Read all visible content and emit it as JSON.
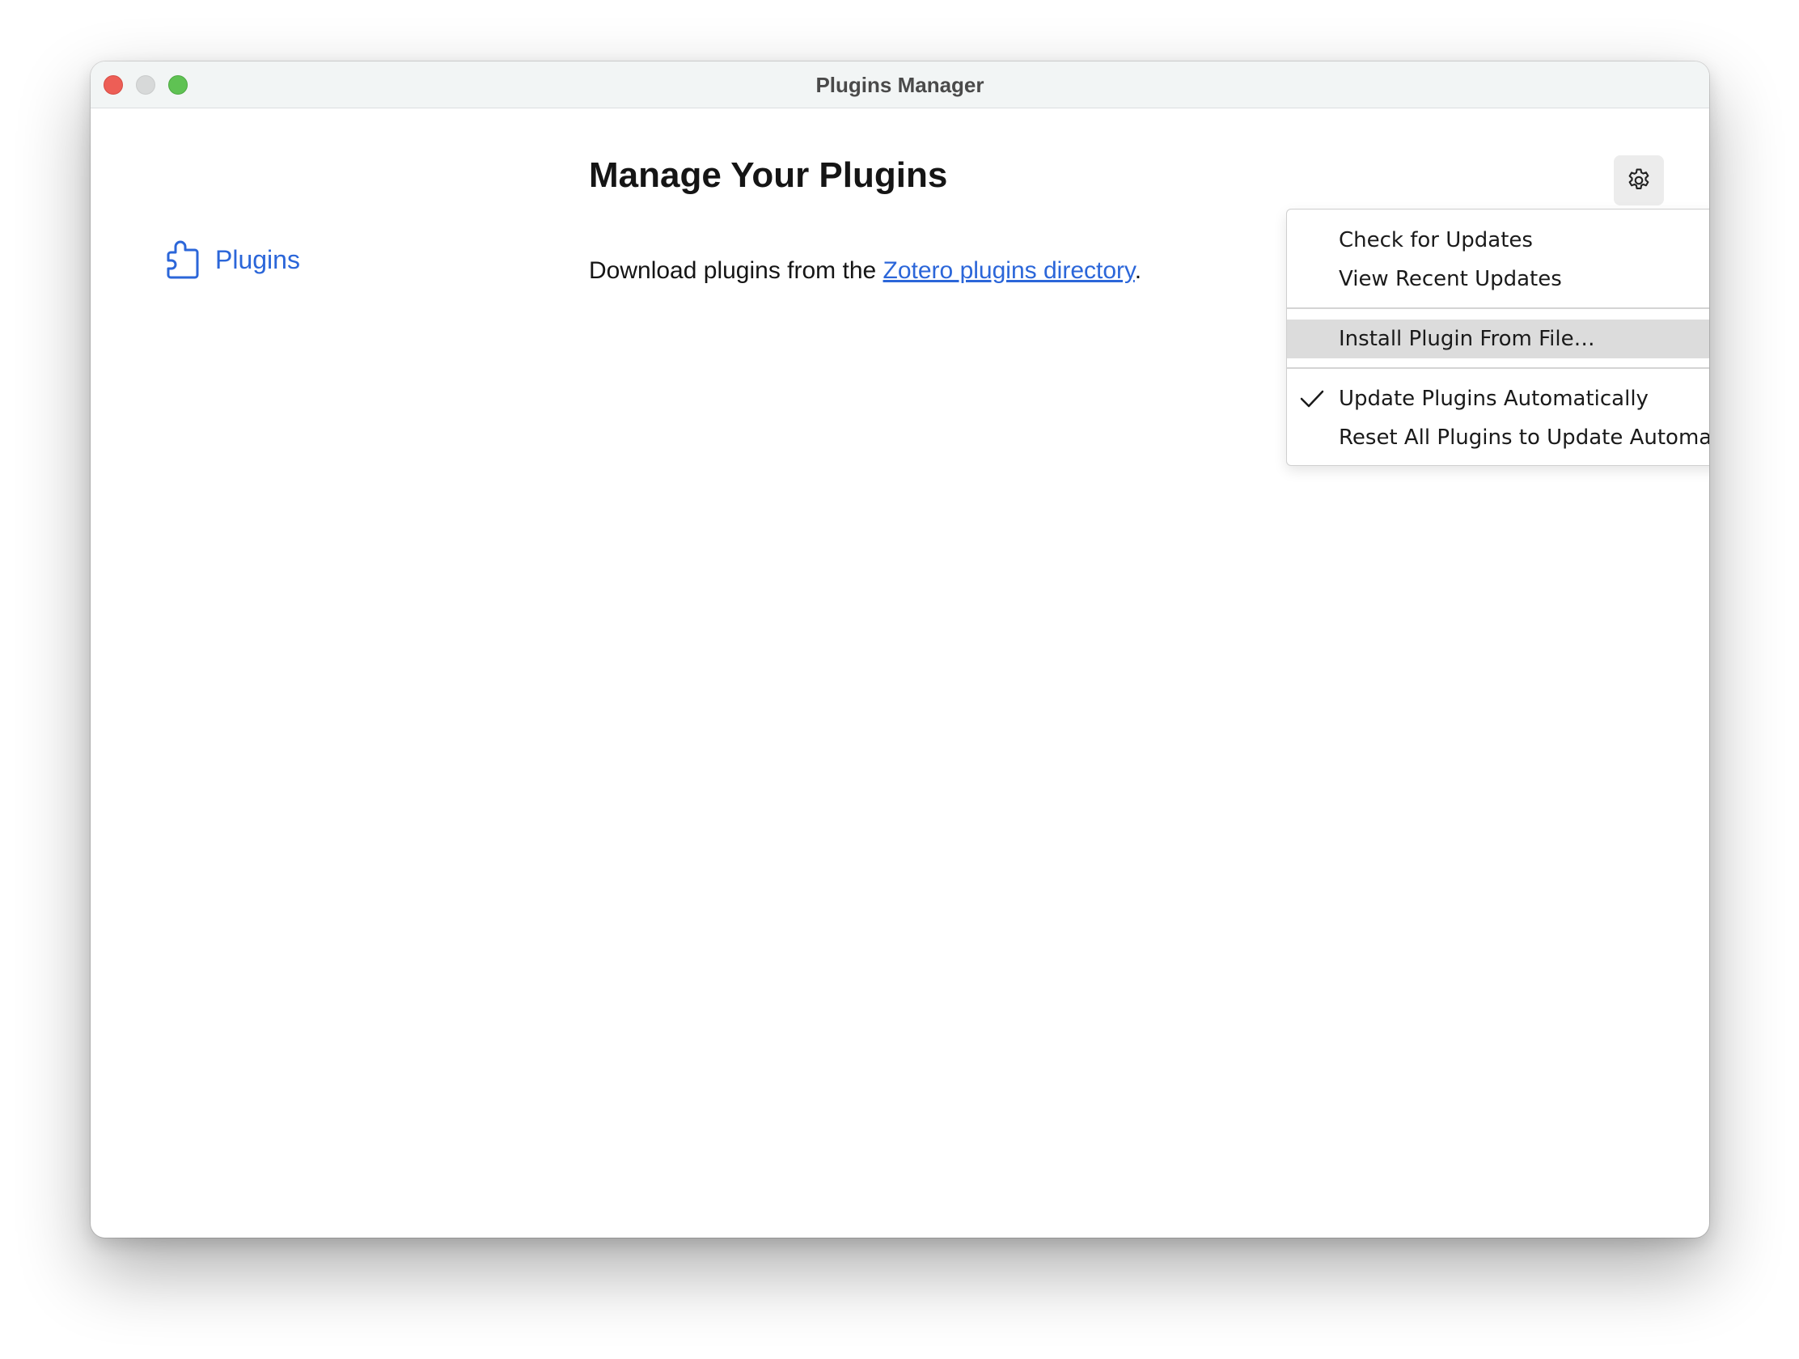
{
  "window": {
    "title": "Plugins Manager"
  },
  "sidebar": {
    "items": [
      {
        "label": "Plugins",
        "icon": "puzzle-piece-icon",
        "selected": true
      }
    ]
  },
  "main": {
    "title": "Manage Your Plugins",
    "intro_prefix": "Download plugins from the ",
    "intro_link": "Zotero plugins directory",
    "intro_suffix": "."
  },
  "toolbar": {
    "settings_icon": "gear-icon"
  },
  "menu": {
    "items": [
      {
        "label": "Check for Updates",
        "checked": false
      },
      {
        "label": "View Recent Updates",
        "checked": false
      },
      {
        "label": "Install Plugin From File…",
        "checked": false,
        "highlighted": true
      },
      {
        "label": "Update Plugins Automatically",
        "checked": true
      },
      {
        "label": "Reset All Plugins to Update Automatically",
        "checked": false
      }
    ]
  },
  "colors": {
    "accent": "#2b66d9",
    "close": "#ed5e56",
    "minimize": "#d7d9d9",
    "maximize": "#5fc253",
    "menu_highlight": "#dcdcdc"
  }
}
